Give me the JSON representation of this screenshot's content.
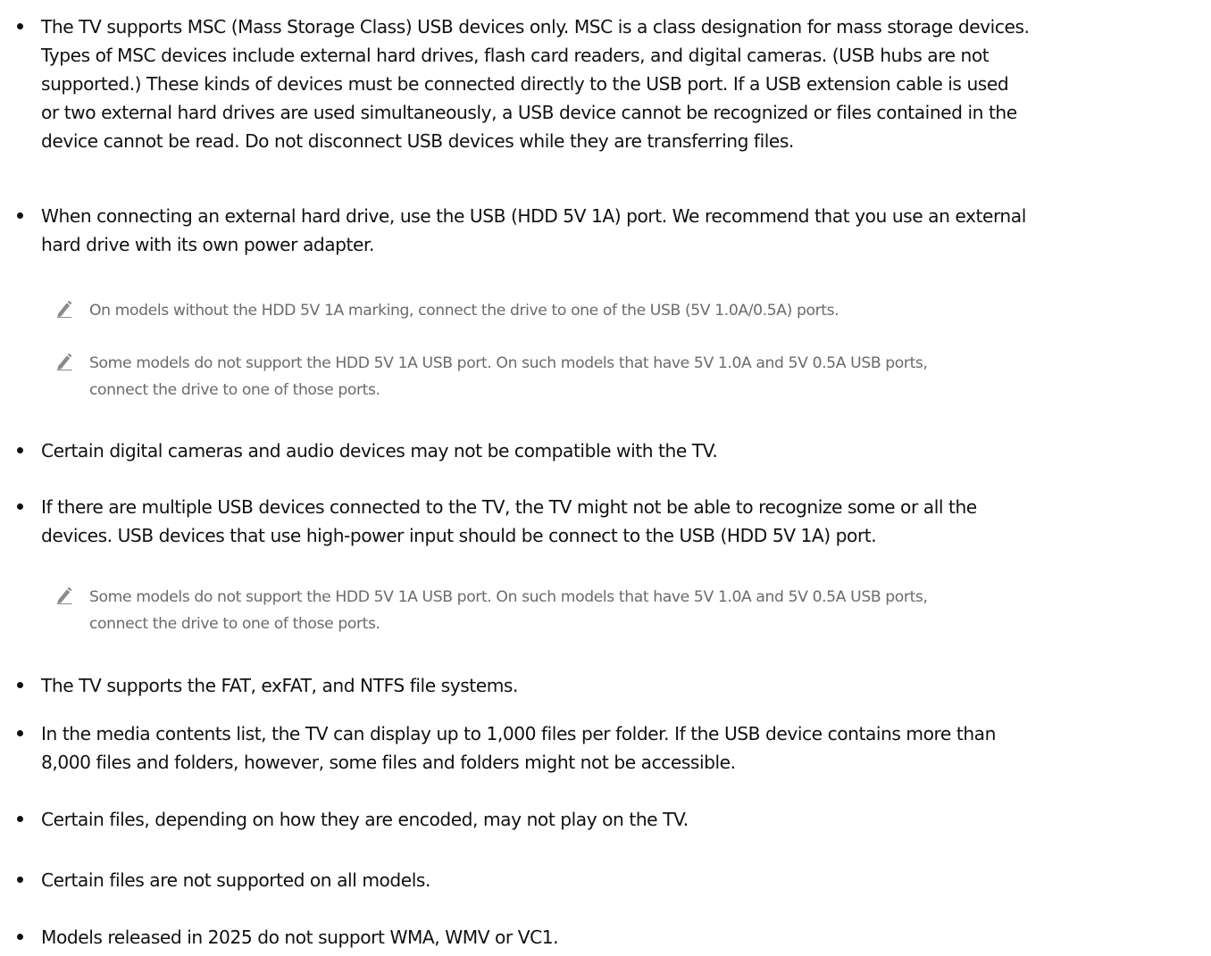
{
  "bullets": [
    {
      "text": "The TV supports MSC (Mass Storage Class) USB devices only. MSC is a class designation for mass storage devices.\nTypes of MSC devices include external hard drives, flash card readers, and digital cameras. (USB hubs are not\nsupported.) These kinds of devices must be connected directly to the USB port. If a USB extension cable is used\nor two external hard drives are used simultaneously, a USB device cannot be recognized or files contained in the\ndevice cannot be read. Do not disconnect USB devices while they are transferring files."
    },
    {
      "text": "When connecting an external hard drive, use the USB (HDD 5V 1A) port. We recommend that you use an external\nhard drive with its own power adapter.",
      "notes": [
        "On models without the HDD 5V 1A marking, connect the drive to one of the USB (5V 1.0A/0.5A) ports.",
        "Some models do not support the HDD 5V 1A USB port. On such models that have 5V 1.0A and 5V 0.5A USB ports,\nconnect the drive to one of those ports."
      ]
    },
    {
      "text": "Certain digital cameras and audio devices may not be compatible with the TV."
    },
    {
      "text": "If there are multiple USB devices connected to the TV, the TV might not be able to recognize some or all the\ndevices. USB devices that use high-power input should be connect to the USB (HDD 5V 1A) port.",
      "notes": [
        "Some models do not support the HDD 5V 1A USB port. On such models that have 5V 1.0A and 5V 0.5A USB ports,\nconnect the drive to one of those ports."
      ]
    },
    {
      "text": "The TV supports the FAT, exFAT, and NTFS file systems."
    },
    {
      "text": "In the media contents list, the TV can display up to 1,000 files per folder. If the USB device contains more than\n8,000 files and folders, however, some files and folders might not be accessible."
    },
    {
      "text": "Certain files, depending on how they are encoded, may not play on the TV."
    },
    {
      "text": "Certain files are not supported on all models."
    },
    {
      "text": "Models released in 2025 do not support WMA, WMV or VC1."
    }
  ],
  "icons": {
    "note": "pencil-note-icon"
  },
  "colors": {
    "body_text": "#111111",
    "note_text": "#6b6b6b",
    "icon": "#8a8a8a"
  }
}
